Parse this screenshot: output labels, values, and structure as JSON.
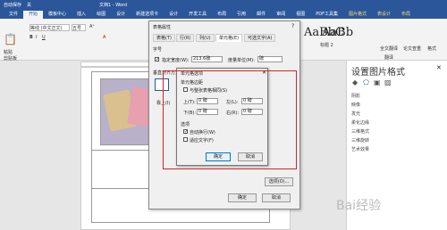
{
  "title_bar": {
    "autosave": "自动保存",
    "toggle": "关",
    "doc": "文档1 - Word"
  },
  "tabs": [
    {
      "label": "文件"
    },
    {
      "label": "开始"
    },
    {
      "label": "模板中心"
    },
    {
      "label": "插入"
    },
    {
      "label": "绘图"
    },
    {
      "label": "设计"
    },
    {
      "label": "新建选项卡"
    },
    {
      "label": "设计"
    },
    {
      "label": "开发工具"
    },
    {
      "label": "布局"
    },
    {
      "label": "引用"
    },
    {
      "label": "邮件"
    },
    {
      "label": "审阅"
    },
    {
      "label": "视图"
    },
    {
      "label": "PDF工具集"
    },
    {
      "label": "图片格式"
    },
    {
      "label": "表设计"
    },
    {
      "label": "布局"
    }
  ],
  "ribbon": {
    "font_name": "等线 (中文正文)",
    "font_size": "五号",
    "style1": "AaBbC",
    "style2": "AaBb",
    "style2_label": "标题 2",
    "paste": "粘贴",
    "clipboard": "剪贴板",
    "word_count": "全文翻译",
    "proofread": "论文查重",
    "translate": "翻译",
    "format": "格式"
  },
  "pane": {
    "title": "设置图片格式",
    "items": [
      "阴影",
      "映像",
      "发光",
      "柔化边缘",
      "三维格式",
      "三维旋转",
      "艺术效果"
    ]
  },
  "dialog_table": {
    "title": "表格属性",
    "tabs": [
      "表格(T)",
      "行(R)",
      "列(U)",
      "单元格(E)",
      "可选文字(A)"
    ],
    "size_label": "字号",
    "pref_width_label": "指定宽度(W):",
    "pref_width": "213.6磅",
    "measure_label": "度量单位(M):",
    "measure": "磅",
    "valign_label": "垂直对齐方式",
    "valign_top": "靠上(I)",
    "options_button": "选项(O)...",
    "ok": "确定",
    "cancel": "取消"
  },
  "dialog_cell": {
    "title": "单元格选项",
    "margins_label": "单元格边距",
    "same_as_table": "与整张表格相同(S)",
    "top_label": "上(T):",
    "top": "0 磅",
    "bottom_label": "下(B):",
    "bottom": "0 磅",
    "left_label": "左(L):",
    "left": "0 磅",
    "right_label": "右(R):",
    "right": "0 磅",
    "options_label": "选项",
    "wrap": "自动换行(W)",
    "fit": "适应文字(F)",
    "ok": "确定",
    "cancel": "取消"
  },
  "watermark": "Bai经验"
}
